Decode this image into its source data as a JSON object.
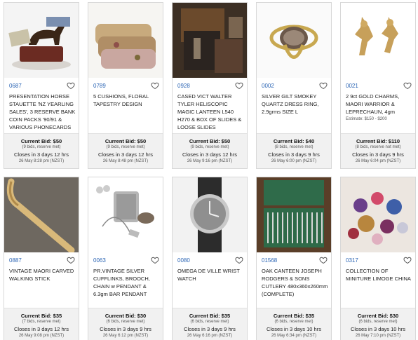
{
  "lots": [
    {
      "lot": "0687",
      "title": "PRESENTATION HORSE STAUETTE 'NZ YEARLING SALES', 3 RESERVE BANK COIN PACKS '90/91 & VARIOUS PHONECARDS",
      "estimate": "",
      "current_bid": "Current Bid: $50",
      "bids": "(9 bids, reserve met)",
      "closes": "Closes in 3 days 12 hrs",
      "date": "26 May 8:28 pm (NZST)",
      "image": "horse-statuette"
    },
    {
      "lot": "0789",
      "title": "5 CUSHIONS, FLORAL TAPESTRY DESIGN",
      "estimate": "",
      "current_bid": "Current Bid: $50",
      "bids": "(9 bids, reserve met)",
      "closes": "Closes in 3 days 12 hrs",
      "date": "26 May 8:48 pm (NZST)",
      "image": "cushions"
    },
    {
      "lot": "0928",
      "title": "CASED VICT WALTER TYLER HELISCOPIC MAGIC LANTEEN L540 H270 & BOX OF SLIDES & LOOSE SLIDES",
      "estimate": "",
      "current_bid": "Current Bid: $50",
      "bids": "(9 bids, reserve met)",
      "closes": "Closes in 3 days 12 hrs",
      "date": "26 May 9:16 pm (NZST)",
      "image": "magic-lantern"
    },
    {
      "lot": "0002",
      "title": "SILVER GILT SMOKEY QUARTZ DRESS RING, 2.9grms SIZE L",
      "estimate": "",
      "current_bid": "Current Bid: $40",
      "bids": "(8 bids, reserve met)",
      "closes": "Closes in 3 days 9 hrs",
      "date": "26 May 6:00 pm (NZST)",
      "image": "ring"
    },
    {
      "lot": "0021",
      "title": "2 9ct GOLD CHARMS, MAORI WARRIOR & LEPRECHAUN, 4gm",
      "estimate": "Estimate: $150 - $200",
      "current_bid": "Current Bid: $110",
      "bids": "(8 bids, reserve not met)",
      "closes": "Closes in 3 days 9 hrs",
      "date": "26 May 6:04 pm (NZST)",
      "image": "gold-charms"
    },
    {
      "lot": "0887",
      "title": "VINTAGE MAORI CARVED WALKING STICK",
      "estimate": "",
      "current_bid": "Current Bid: $35",
      "bids": "(7 bids, reserve met)",
      "closes": "Closes in 3 days 12 hrs",
      "date": "26 May 9:08 pm (NZST)",
      "image": "walking-stick"
    },
    {
      "lot": "0063",
      "title": "PR.VINTAGE SILVER CUFFLINKS, BROOCH, CHAIN w PENDANT & 6.3gm BAR PENDANT",
      "estimate": "",
      "current_bid": "Current Bid: $30",
      "bids": "(6 bids, reserve met)",
      "closes": "Closes in 3 days 9 hrs",
      "date": "26 May 6:12 pm (NZST)",
      "image": "silver-jewellery"
    },
    {
      "lot": "0080",
      "title": "OMEGA DE VILLE WRIST WATCH",
      "estimate": "",
      "current_bid": "Current Bid: $35",
      "bids": "(6 bids, reserve met)",
      "closes": "Closes in 3 days 9 hrs",
      "date": "26 May 6:16 pm (NZST)",
      "image": "wrist-watch"
    },
    {
      "lot": "01568",
      "title": "OAK CANTEEN JOSEPH RODGERS & SONS CUTLERY 480x360x260mm (COMPLETE)",
      "estimate": "",
      "current_bid": "Current Bid: $35",
      "bids": "(6 bids, reserve met)",
      "closes": "Closes in 3 days 10 hrs",
      "date": "26 May 6:34 pm (NZST)",
      "image": "cutlery-canteen"
    },
    {
      "lot": "0317",
      "title": "COLLECTION OF MINITURE LIMOGE CHINA",
      "estimate": "",
      "current_bid": "Current Bid: $30",
      "bids": "(6 bids, reserve met)",
      "closes": "Closes in 3 days 10 hrs",
      "date": "26 May 7:10 pm (NZST)",
      "image": "limoge-china"
    }
  ],
  "colors": {
    "lot_link": "#2a64b4",
    "bid_panel": "#f1f1f1",
    "border": "#d8d8d8"
  }
}
